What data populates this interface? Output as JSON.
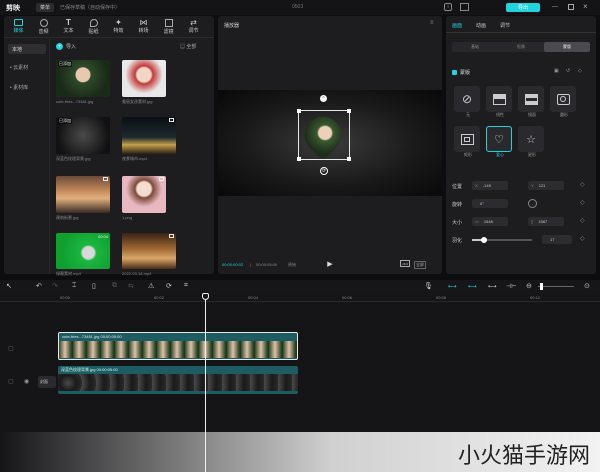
{
  "topbar": {
    "logo": "剪映",
    "menu_label": "菜单",
    "autosave": "已保存草稿（自动保存中）",
    "project_name": "0503",
    "export_label": "导出"
  },
  "toolbar": {
    "tabs": [
      {
        "label": "媒体",
        "icon": "media-icon"
      },
      {
        "label": "音频",
        "icon": "audio-icon"
      },
      {
        "label": "文本",
        "icon": "text-icon"
      },
      {
        "label": "贴纸",
        "icon": "sticker-icon"
      },
      {
        "label": "特效",
        "icon": "effects-icon"
      },
      {
        "label": "转场",
        "icon": "transition-icon"
      },
      {
        "label": "滤镜",
        "icon": "filter-icon"
      },
      {
        "label": "调节",
        "icon": "adjust-icon"
      }
    ]
  },
  "media_nav": {
    "items": [
      "本地",
      "• 云素材",
      "• 素材库"
    ]
  },
  "media_header": {
    "import_label": "导入",
    "sort_label": "全部"
  },
  "media_items": [
    {
      "name": "cute-fries...73481.jpg",
      "badge": "已添加"
    },
    {
      "name": "美丽女孩素材.jpg",
      "badge": ""
    },
    {
      "name": "深蓝色纹理背景.jpg",
      "badge": "已添加"
    },
    {
      "name": "夜景城市.mp4",
      "badge": ""
    },
    {
      "name": "建筑街景.jpg",
      "badge": ""
    },
    {
      "name": "1.png",
      "badge": ""
    },
    {
      "name": "绿幕素材.mp4",
      "badge": "00:04"
    },
    {
      "name": "2022-03-18.mp4",
      "badge": ""
    }
  ],
  "player": {
    "title": "播放器",
    "time_current": "00:00:00:02",
    "time_total": "00:00:05:00",
    "ratio_label": "原始",
    "fullscreen_label": "全屏"
  },
  "inspector": {
    "tabs": [
      "画面",
      "动画",
      "调节"
    ],
    "subtabs": [
      "基础",
      "抠像",
      "蒙版"
    ],
    "section_title": "蒙版",
    "masks": [
      "无",
      "线性",
      "镜面",
      "圆形",
      "矩形",
      "爱心",
      "星形"
    ],
    "position_label": "位置",
    "pos_x": "-149",
    "pos_y": "121",
    "rotate_label": "旋转",
    "rotate_value": "0°",
    "size_label": "大小",
    "size_w": "1546",
    "size_h": "1587",
    "feather_label": "羽化",
    "feather_value": "17"
  },
  "timeline": {
    "ruler": [
      "00:00",
      "00:02",
      "00:04",
      "00:06",
      "00:08",
      "00:10"
    ],
    "clip1_label": "cute-fries...73481.jpg  00:00:05:00",
    "clip2_label": "深蓝色纹理背景.jpg  00:00:05:00",
    "cover_label": "封面"
  },
  "watermark": "小火猫手游网",
  "colors": {
    "accent": "#21d3dc",
    "panel": "#1d1d20",
    "background": "#0d0d0f",
    "clip": "#1d5c63"
  }
}
